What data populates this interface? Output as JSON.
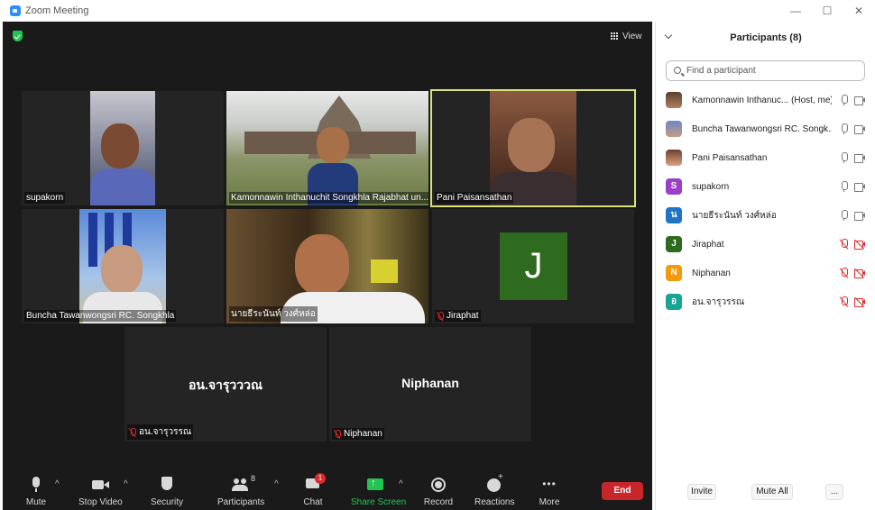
{
  "window": {
    "title": "Zoom Meeting",
    "minimize": "—",
    "maximize": "☐",
    "close": "✕"
  },
  "view": {
    "label": "View"
  },
  "tiles": [
    {
      "name": "supakorn"
    },
    {
      "name": "Kamonnawin Inthanuchit Songkhla Rajabhat un..."
    },
    {
      "name": "Pani Paisansathan"
    },
    {
      "name": "Buncha Tawanwongsri RC. Songkhla"
    },
    {
      "name": "นายธีระนันท์ วงศ์หล่อ"
    },
    {
      "name": "Jiraphat",
      "initial": "J"
    },
    {
      "name": "อน.จารุวรรณ",
      "big": "อน.จารุวววณ"
    },
    {
      "name": "Niphanan",
      "big": "Niphanan"
    }
  ],
  "toolbar": {
    "mute": "Mute",
    "stop_video": "Stop Video",
    "security": "Security",
    "participants": "Participants",
    "participants_count": "8",
    "chat": "Chat",
    "chat_badge": "1",
    "share_screen": "Share Screen",
    "record": "Record",
    "reactions": "Reactions",
    "more": "More",
    "end": "End"
  },
  "panel": {
    "title": "Participants (8)",
    "search_placeholder": "Find a participant",
    "participants": [
      {
        "name": "Kamonnawin Inthanuc...  (Host, me)",
        "avatar": "",
        "avatar_color": "",
        "muted": false,
        "video_off": false
      },
      {
        "name": "Buncha Tawanwongsri RC. Songk...",
        "avatar": "",
        "avatar_color": "",
        "muted": false,
        "video_off": false
      },
      {
        "name": "Pani Paisansathan",
        "avatar": "",
        "avatar_color": "",
        "muted": false,
        "video_off": false
      },
      {
        "name": "supakorn",
        "avatar": "S",
        "avatar_color": "#9b3fc8",
        "muted": false,
        "video_off": false
      },
      {
        "name": "นายธีระนันท์ วงศ์หล่อ",
        "avatar": "น",
        "avatar_color": "#1f74c8",
        "muted": false,
        "video_off": false
      },
      {
        "name": "Jiraphat",
        "avatar": "J",
        "avatar_color": "#2e6b1e",
        "muted": true,
        "video_off": true
      },
      {
        "name": "Niphanan",
        "avatar": "N",
        "avatar_color": "#f29a0c",
        "muted": true,
        "video_off": true
      },
      {
        "name": "อน.จารุวรรณ",
        "avatar": "อ",
        "avatar_color": "#17a596",
        "muted": true,
        "video_off": true
      }
    ],
    "invite": "Invite",
    "mute_all": "Mute All",
    "more": "..."
  },
  "colors": {
    "active_speaker_border": "#d9e37a",
    "end_button": "#c8262a",
    "share_green": "#23c552",
    "muted_red": "#e02828"
  }
}
